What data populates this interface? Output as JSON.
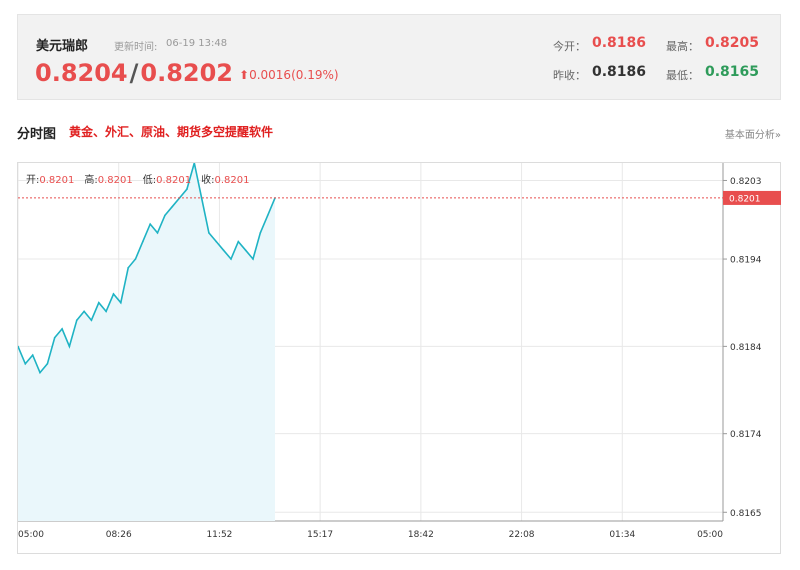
{
  "quote": {
    "name": "美元瑞郎",
    "time_label": "更新时间:",
    "time": "06-19 13:48",
    "bid": "0.8204",
    "slash": "/",
    "ask": "0.8202",
    "change": "0.0016(0.19%)",
    "direction": "up",
    "open_label": "今开：",
    "open": "0.8186",
    "high_label": "最高：",
    "high": "0.8205",
    "prev_close_label": "昨收：",
    "prev_close": "0.8186",
    "low_label": "最低：",
    "low": "0.8165",
    "colors": {
      "up": "#e84e4e",
      "down": "#2e9b5a",
      "neutral": "#333333"
    }
  },
  "chart_header": {
    "title": "分时图",
    "promo": "黄金、外汇、原油、期货多空提醒软件",
    "more_link": "基本面分析»"
  },
  "ohlc_bar": {
    "open_label": "开:",
    "open": "0.8201",
    "high_label": "高:",
    "high": "0.8201",
    "low_label": "低:",
    "low": "0.8201",
    "close_label": "收:",
    "close": "0.8201"
  },
  "chart_data": {
    "type": "area",
    "title": "",
    "xlabel": "",
    "ylabel": "",
    "x_ticks": [
      "05:00",
      "08:26",
      "11:52",
      "15:17",
      "18:42",
      "22:08",
      "01:34",
      "05:00"
    ],
    "y_ticks": [
      0.8203,
      0.8194,
      0.8184,
      0.8174,
      0.8165
    ],
    "y_tick_labels": [
      "0.8203",
      "0.8194",
      "0.8184",
      "0.8174",
      "0.8165"
    ],
    "ylim": [
      0.8164,
      0.8205
    ],
    "x_range_hours": [
      0,
      24
    ],
    "current_price": 0.8201,
    "current_price_label": "0.8201",
    "series": [
      {
        "x": [
          0,
          0.25,
          0.5,
          0.75,
          1.0,
          1.25,
          1.5,
          1.75,
          2.0,
          2.25,
          2.5,
          2.75,
          3.0,
          3.25,
          3.5,
          3.75,
          4.0,
          4.25,
          4.5,
          4.75,
          5.0,
          5.25,
          5.5,
          5.75,
          6.0,
          6.25,
          6.5,
          6.75,
          7.0,
          7.25,
          7.5,
          7.75,
          8.0,
          8.25,
          8.5,
          8.75
        ],
        "y": [
          0.8184,
          0.8182,
          0.8183,
          0.8181,
          0.8182,
          0.8185,
          0.8186,
          0.8184,
          0.8187,
          0.8188,
          0.8187,
          0.8189,
          0.8188,
          0.819,
          0.8189,
          0.8193,
          0.8194,
          0.8196,
          0.8198,
          0.8197,
          0.8199,
          0.82,
          0.8201,
          0.8202,
          0.8205,
          0.8201,
          0.8197,
          0.8196,
          0.8195,
          0.8194,
          0.8196,
          0.8195,
          0.8194,
          0.8197,
          0.8199,
          0.8201
        ]
      }
    ],
    "colors": {
      "line": "#1fb3c4",
      "fill": "#eaf7fb",
      "current_line": "#e84e4e",
      "grid": "#e8e8e8"
    }
  }
}
